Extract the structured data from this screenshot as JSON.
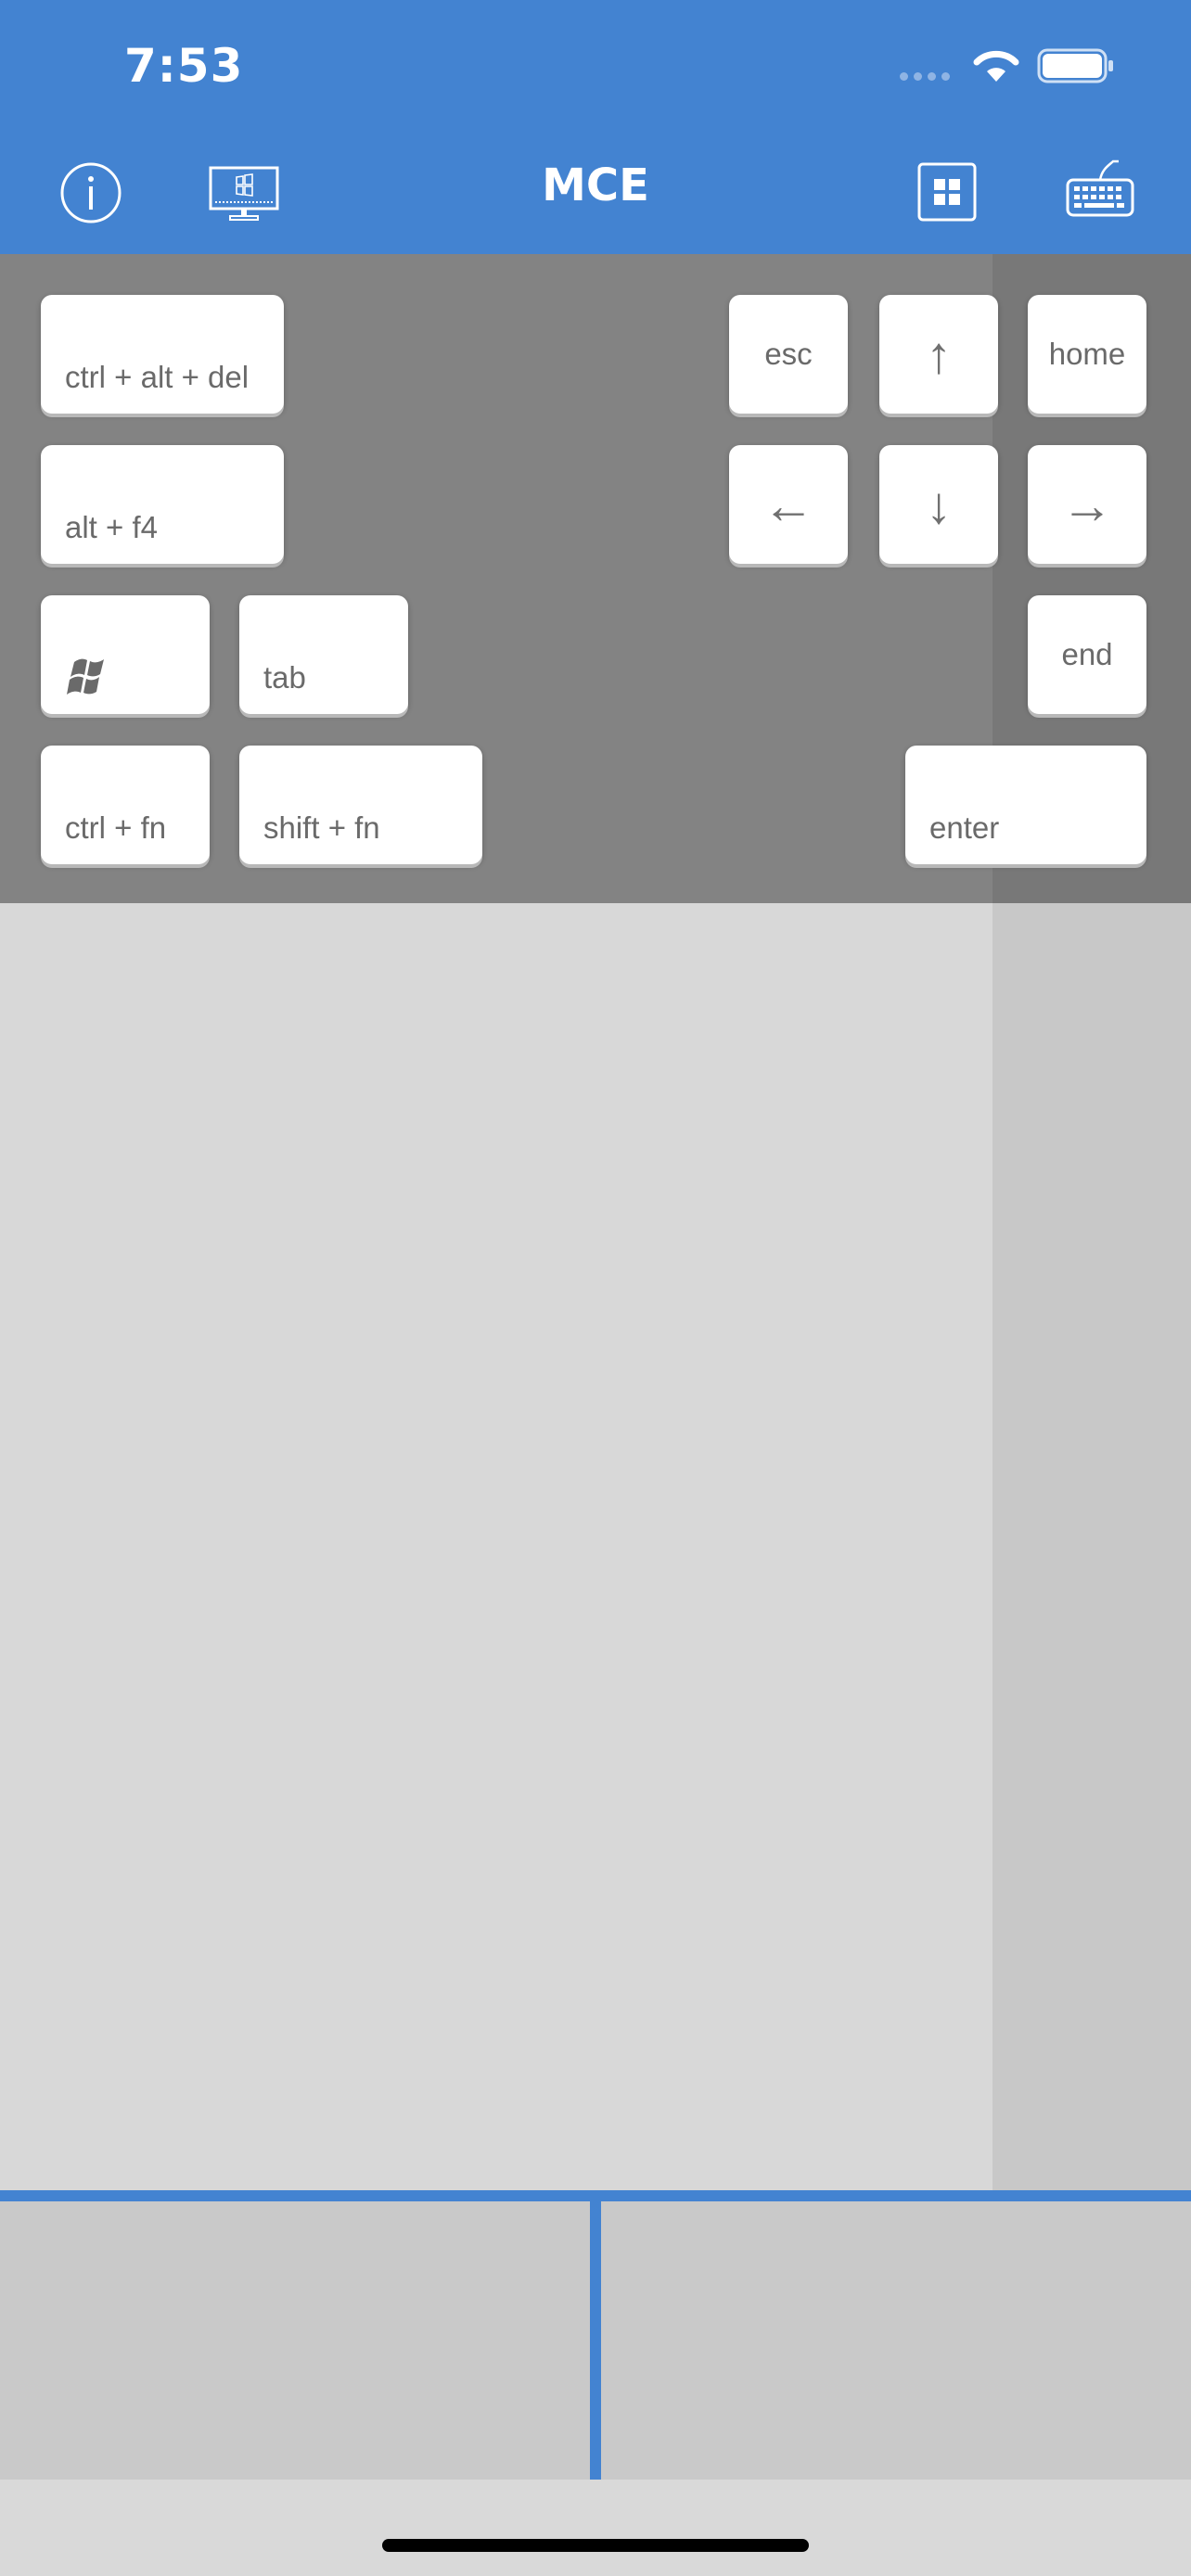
{
  "status_bar": {
    "time": "7:53"
  },
  "nav": {
    "title": "MCE"
  },
  "keys": {
    "ctrl_alt_del": "ctrl + alt + del",
    "alt_f4": "alt + f4",
    "tab": "tab",
    "ctrl_fn": "ctrl + fn",
    "shift_fn": "shift  + fn",
    "esc": "esc",
    "up": "↑",
    "home": "home",
    "left": "←",
    "down": "↓",
    "right": "→",
    "end": "end",
    "enter": "enter"
  },
  "colors": {
    "accent": "#4383d1",
    "keys_panel": "#838383",
    "trackpad": "#d8d8d8",
    "scrollbar": "#c8c8c8"
  }
}
